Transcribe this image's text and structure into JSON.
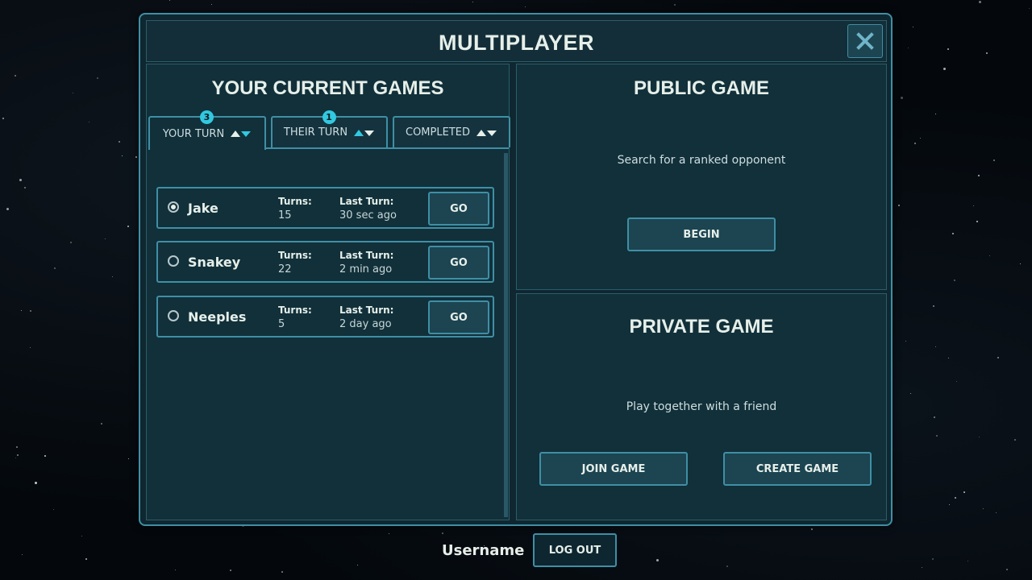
{
  "window": {
    "title": "MULTIPLAYER",
    "close_icon": "close-icon"
  },
  "current_games": {
    "title": "YOUR CURRENT GAMES",
    "tabs": [
      {
        "label": "YOUR TURN",
        "badge": "3",
        "icon": "sort-arrows-icon"
      },
      {
        "label": "THEIR TURN",
        "badge": "1",
        "icon": "sort-arrows-icon"
      },
      {
        "label": "COMPLETED",
        "badge": "",
        "icon": "sort-arrows-icon"
      }
    ],
    "active_tab": "YOUR TURN",
    "turns_label": "Turns:",
    "last_turn_label": "Last Turn:",
    "go_label": "GO",
    "games": [
      {
        "player": "Jake",
        "turns": "15",
        "last_turn": "30 sec ago",
        "selected": true
      },
      {
        "player": "Snakey",
        "turns": "22",
        "last_turn": "2 min ago",
        "selected": false
      },
      {
        "player": "Neeples",
        "turns": "5",
        "last_turn": "2 day ago",
        "selected": false
      }
    ]
  },
  "public_game": {
    "title": "PUBLIC GAME",
    "description": "Search for a ranked opponent",
    "begin_label": "BEGIN"
  },
  "private_game": {
    "title": "PRIVATE GAME",
    "description": "Play together with a friend",
    "join_label": "JOIN GAME",
    "create_label": "CREATE GAME"
  },
  "footer": {
    "username": "Username",
    "logout_label": "LOG OUT"
  },
  "colors": {
    "accent": "#3f8fa5",
    "badge": "#32c8e0",
    "panel": "#11303a",
    "text": "#e6efe9"
  }
}
